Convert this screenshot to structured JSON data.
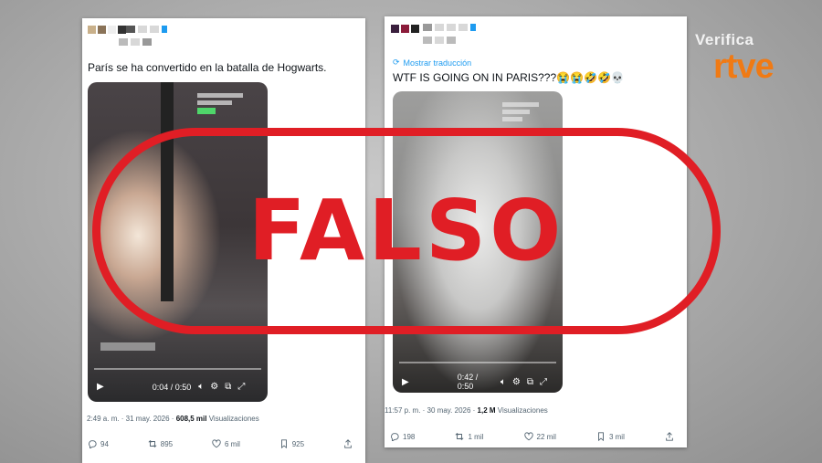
{
  "colors": {
    "stamp_red": "#e01e25",
    "rtve_orange": "#f07a14",
    "link_blue": "#1d9bf0"
  },
  "tweet1": {
    "text": "París se ha convertido en la batalla de Hogwarts.",
    "video_time": "0:04 / 0:50",
    "meta_time": "2:49 a. m. · 31 may. 2026 · ",
    "views_count": "608,5 mil",
    "views_label": " Visualizaciones",
    "replies": "94",
    "reposts": "895",
    "likes": "6 mil",
    "bookmarks": "925"
  },
  "tweet2": {
    "translate_label": "Mostrar traducción",
    "text": "WTF IS GOING ON IN PARIS???😭😭🤣🤣💀",
    "video_time": "0:42 / 0:50",
    "meta_time": "11:57 p. m. · 30 may. 2026 · ",
    "views_count": "1,2 M",
    "views_label": " Visualizaciones",
    "replies": "198",
    "reposts": "1 mil",
    "likes": "22 mil",
    "bookmarks": "3 mil"
  },
  "stamp": {
    "label": "FALSO"
  },
  "logo": {
    "verifica": "Verifica",
    "brand": "rtve"
  }
}
